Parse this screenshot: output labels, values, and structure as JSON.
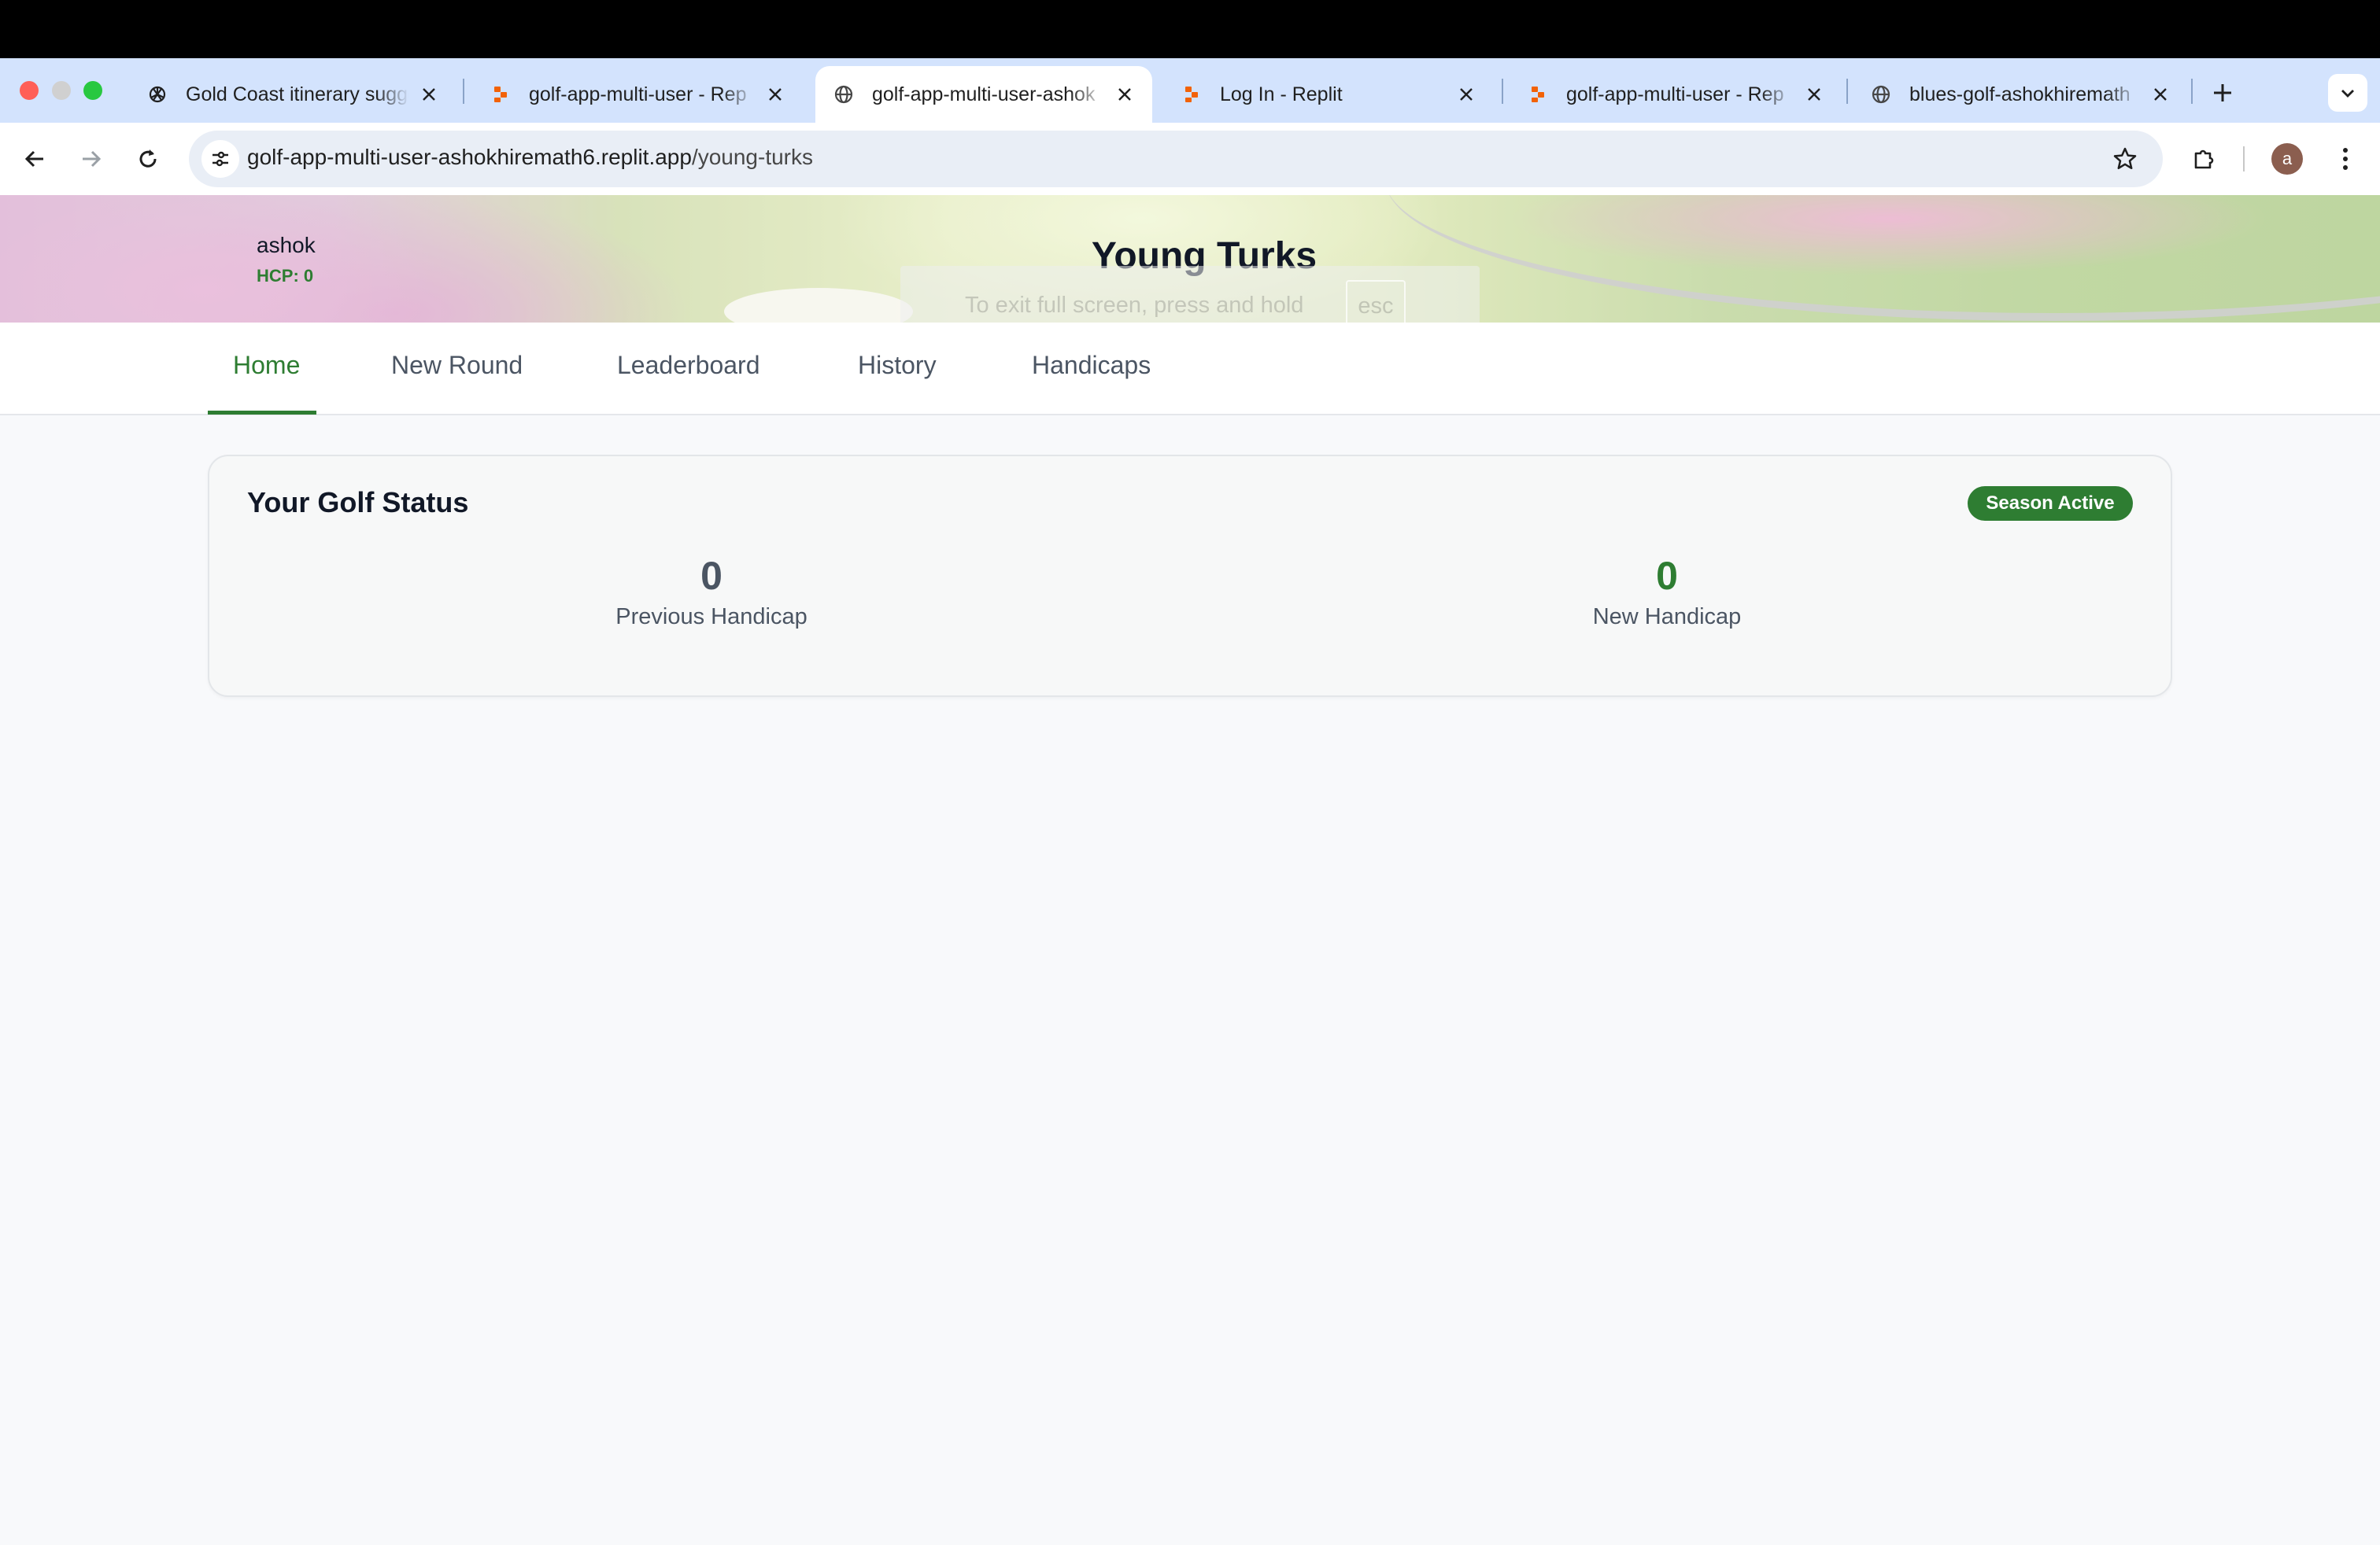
{
  "browser": {
    "tabs": [
      {
        "title": "Gold Coast itinerary sugge",
        "icon": "openai-icon",
        "active": false
      },
      {
        "title": "golf-app-multi-user - Rep",
        "icon": "replit-icon",
        "active": false
      },
      {
        "title": "golf-app-multi-user-ashok",
        "icon": "globe-icon",
        "active": true
      },
      {
        "title": "Log In - Replit",
        "icon": "replit-icon",
        "active": false
      },
      {
        "title": "golf-app-multi-user - Rep",
        "icon": "replit-icon",
        "active": false
      },
      {
        "title": "blues-golf-ashokhiremath",
        "icon": "globe-icon",
        "active": false
      }
    ],
    "url_host": "golf-app-multi-user-ashokhiremath6.replit.app",
    "url_path": "/young-turks",
    "profile_initial": "a"
  },
  "header": {
    "user_name": "ashok",
    "user_hcp": "HCP: 0",
    "club_title": "Young Turks",
    "fullscreen_hint": "To exit full screen, press and hold",
    "fullscreen_key": "esc"
  },
  "nav": {
    "items": [
      {
        "label": "Home",
        "active": true
      },
      {
        "label": "New Round",
        "active": false
      },
      {
        "label": "Leaderboard",
        "active": false
      },
      {
        "label": "History",
        "active": false
      },
      {
        "label": "Handicaps",
        "active": false
      }
    ]
  },
  "status_card": {
    "title": "Your Golf Status",
    "badge": "Season Active",
    "previous_handicap_value": "0",
    "previous_handicap_label": "Previous Handicap",
    "new_handicap_value": "0",
    "new_handicap_label": "New Handicap"
  },
  "colors": {
    "accent": "#2e7d32",
    "tabstrip": "#d3e3fd",
    "page_bg": "#f8f9fb"
  }
}
